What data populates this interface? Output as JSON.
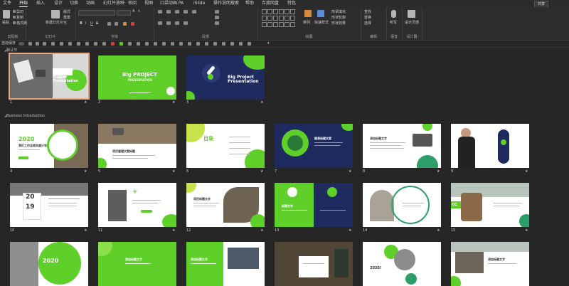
{
  "menu": {
    "items": [
      {
        "label": "文件",
        "active": false
      },
      {
        "label": "开始",
        "active": true
      },
      {
        "label": "插入",
        "active": false
      },
      {
        "label": "设计",
        "active": false
      },
      {
        "label": "切换",
        "active": false
      },
      {
        "label": "动画",
        "active": false
      },
      {
        "label": "幻灯片放映",
        "active": false
      },
      {
        "label": "审阅",
        "active": false
      },
      {
        "label": "视图",
        "active": false
      },
      {
        "label": "口袋动画 PA",
        "active": false
      },
      {
        "label": "iSlide",
        "active": false
      },
      {
        "label": "操作说明搜索",
        "active": false
      },
      {
        "label": "帮助",
        "active": false
      },
      {
        "label": "百度网盘",
        "active": false
      },
      {
        "label": "特色",
        "active": false
      }
    ],
    "share_label": "共享"
  },
  "ribbon": {
    "groups": [
      {
        "label": "剪贴板"
      },
      {
        "label": "幻灯片"
      },
      {
        "label": "字体"
      },
      {
        "label": "段落"
      },
      {
        "label": "绘图"
      },
      {
        "label": "编辑"
      },
      {
        "label": "语音"
      },
      {
        "label": "设计器"
      }
    ],
    "clipboard": {
      "paste": "粘贴",
      "cut": "剪切",
      "copy": "复制",
      "format": "格式刷"
    },
    "slides": {
      "new_slide": "新建幻灯片",
      "layout": "版式",
      "reset": "重置",
      "section": "节"
    },
    "font": {
      "bold": "B",
      "italic": "I",
      "underline": "U",
      "strike": "S",
      "size_up": "A",
      "size_down": "A"
    },
    "drawing": {
      "arrange": "排列",
      "quick_styles": "快速样式",
      "fill": "形状填充",
      "outline": "形状轮廓",
      "effects": "形状效果"
    },
    "editing": {
      "find": "查找",
      "replace": "替换",
      "select": "选择"
    },
    "voice": {
      "dictate": "听写"
    },
    "designer": {
      "ideas": "设计灵感"
    }
  },
  "qat": {
    "autosave_label": "自动保存"
  },
  "sections": [
    {
      "label": "默认节"
    },
    {
      "label": "Business Introduction"
    }
  ],
  "slides": [
    {
      "num": "1",
      "title": "",
      "selected": true
    },
    {
      "num": "2",
      "title": "Big PROJECT",
      "subtitle": "PRESENTATION"
    },
    {
      "num": "3",
      "title": "Big Project Presentation"
    },
    {
      "num": "4",
      "title": "2020",
      "subtitle": "我们工作总结年度计划"
    },
    {
      "num": "5",
      "title": "项目管理文案标题"
    },
    {
      "num": "6",
      "title": "目录"
    },
    {
      "num": "7",
      "title": "图表标题文案"
    },
    {
      "num": "8",
      "title": "添加标题文字"
    },
    {
      "num": "9",
      "title": ""
    },
    {
      "num": "10",
      "title": "20",
      "subtitle": "19"
    },
    {
      "num": "11",
      "title": "+"
    },
    {
      "num": "12",
      "title": "项目标题文字"
    },
    {
      "num": "13",
      "title": "标题文字"
    },
    {
      "num": "14",
      "title": ""
    },
    {
      "num": "15",
      "title": "01"
    },
    {
      "num": "16",
      "title": "2020"
    },
    {
      "num": "17",
      "title": "添加标题文字"
    },
    {
      "num": "18",
      "title": "添加标题文字"
    },
    {
      "num": "19",
      "title": ""
    },
    {
      "num": "20",
      "title": "2020!"
    },
    {
      "num": "21",
      "title": "添加标题文字"
    }
  ],
  "colors": {
    "accent": "#5fcf2a",
    "navy": "#1f2a5e",
    "selection": "#e8a77c"
  }
}
